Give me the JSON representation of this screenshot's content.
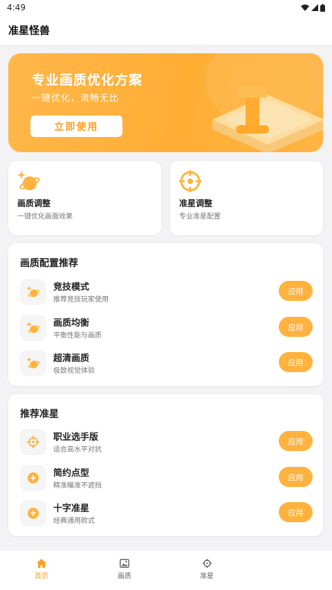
{
  "status_bar": {
    "time": "4:49"
  },
  "header": {
    "title": "准星怪兽"
  },
  "banner": {
    "title": "专业画质优化方案",
    "subtitle": "一键优化，流畅无比",
    "button_label": "立即使用"
  },
  "features": [
    {
      "title": "画质调整",
      "desc": "一键优化画面效果",
      "icon": "planet-sparkle-icon"
    },
    {
      "title": "准星调整",
      "desc": "专业准星配置",
      "icon": "crosshair-icon"
    }
  ],
  "quality_section": {
    "title": "画质配置推荐",
    "items": [
      {
        "title": "竞技模式",
        "desc": "推荐竞技玩家使用",
        "button": "应用"
      },
      {
        "title": "画质均衡",
        "desc": "平衡性能与画质",
        "button": "应用"
      },
      {
        "title": "超清画质",
        "desc": "极致视觉体验",
        "button": "应用"
      }
    ]
  },
  "crosshair_section": {
    "title": "推荐准星",
    "items": [
      {
        "title": "职业选手版",
        "desc": "适合高水平对抗",
        "button": "应用",
        "icon": "crosshair-icon"
      },
      {
        "title": "简约点型",
        "desc": "精准瞄准不遮挡",
        "button": "应用",
        "icon": "plus-circle-icon"
      },
      {
        "title": "十字准星",
        "desc": "经典通用款式",
        "button": "应用",
        "icon": "plus-circle-icon"
      }
    ]
  },
  "bottom_nav": [
    {
      "label": "首页",
      "icon": "home-icon",
      "active": true
    },
    {
      "label": "画质",
      "icon": "image-icon",
      "active": false
    },
    {
      "label": "准星",
      "icon": "crosshair-icon",
      "active": false
    }
  ],
  "colors": {
    "accent": "#ffb23e",
    "accent_dark": "#ff9e24"
  }
}
